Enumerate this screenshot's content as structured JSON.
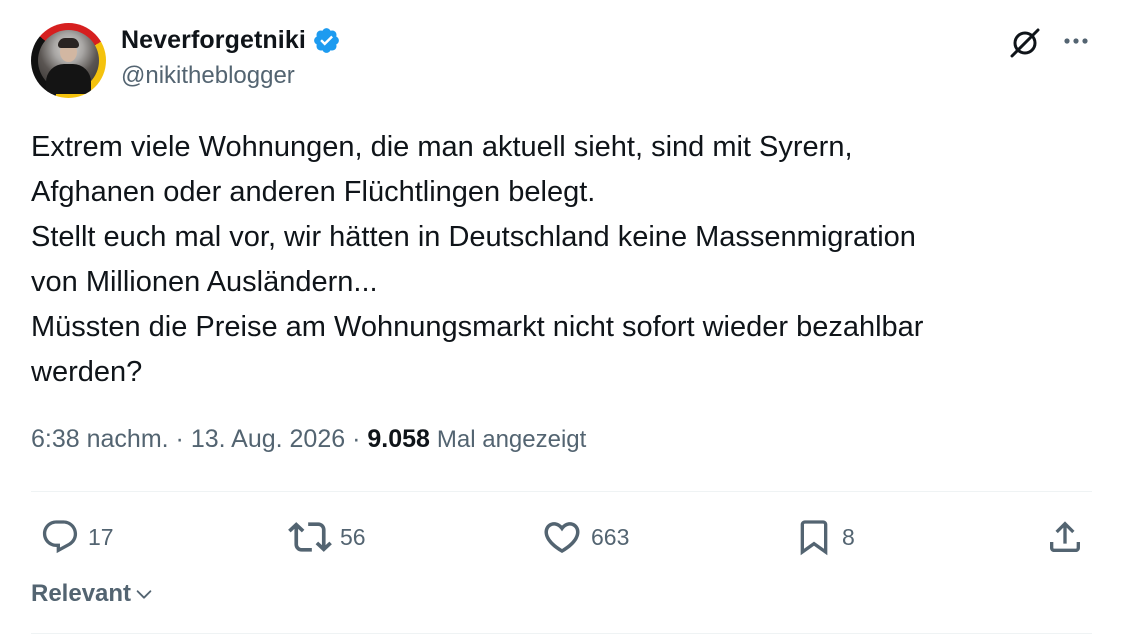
{
  "author": {
    "display_name": "Neverforgetniki",
    "handle": "@nikitheblogger",
    "verified": true,
    "verified_color": "#1d9bf0"
  },
  "tweet": {
    "lines": [
      "Extrem viele Wohnungen, die man aktuell sieht, sind mit Syrern,",
      "Afghanen oder anderen Flüchtlingen belegt.",
      "Stellt euch mal vor, wir hätten in Deutschland keine Massenmigration",
      "von Millionen Ausländern...",
      "Müssten die Preise am Wohnungsmarkt nicht sofort wieder bezahlbar",
      "werden?"
    ]
  },
  "meta": {
    "time": "6:38 nachm.",
    "separator": "·",
    "date": "13. Aug. 2026",
    "views_count": "9.058",
    "views_label": "Mal angezeigt"
  },
  "actions": {
    "replies": "17",
    "reposts": "56",
    "likes": "663",
    "bookmarks": "8"
  },
  "sort": {
    "label": "Relevant"
  },
  "icons": {
    "header": [
      "grok-icon",
      "more-icon"
    ],
    "actions": [
      "reply-icon",
      "repost-icon",
      "like-icon",
      "bookmark-icon",
      "share-icon"
    ],
    "sort": "chevron-down-icon"
  },
  "colors": {
    "text_primary": "#0f1419",
    "text_secondary": "#536471",
    "divider": "#eff3f4"
  }
}
